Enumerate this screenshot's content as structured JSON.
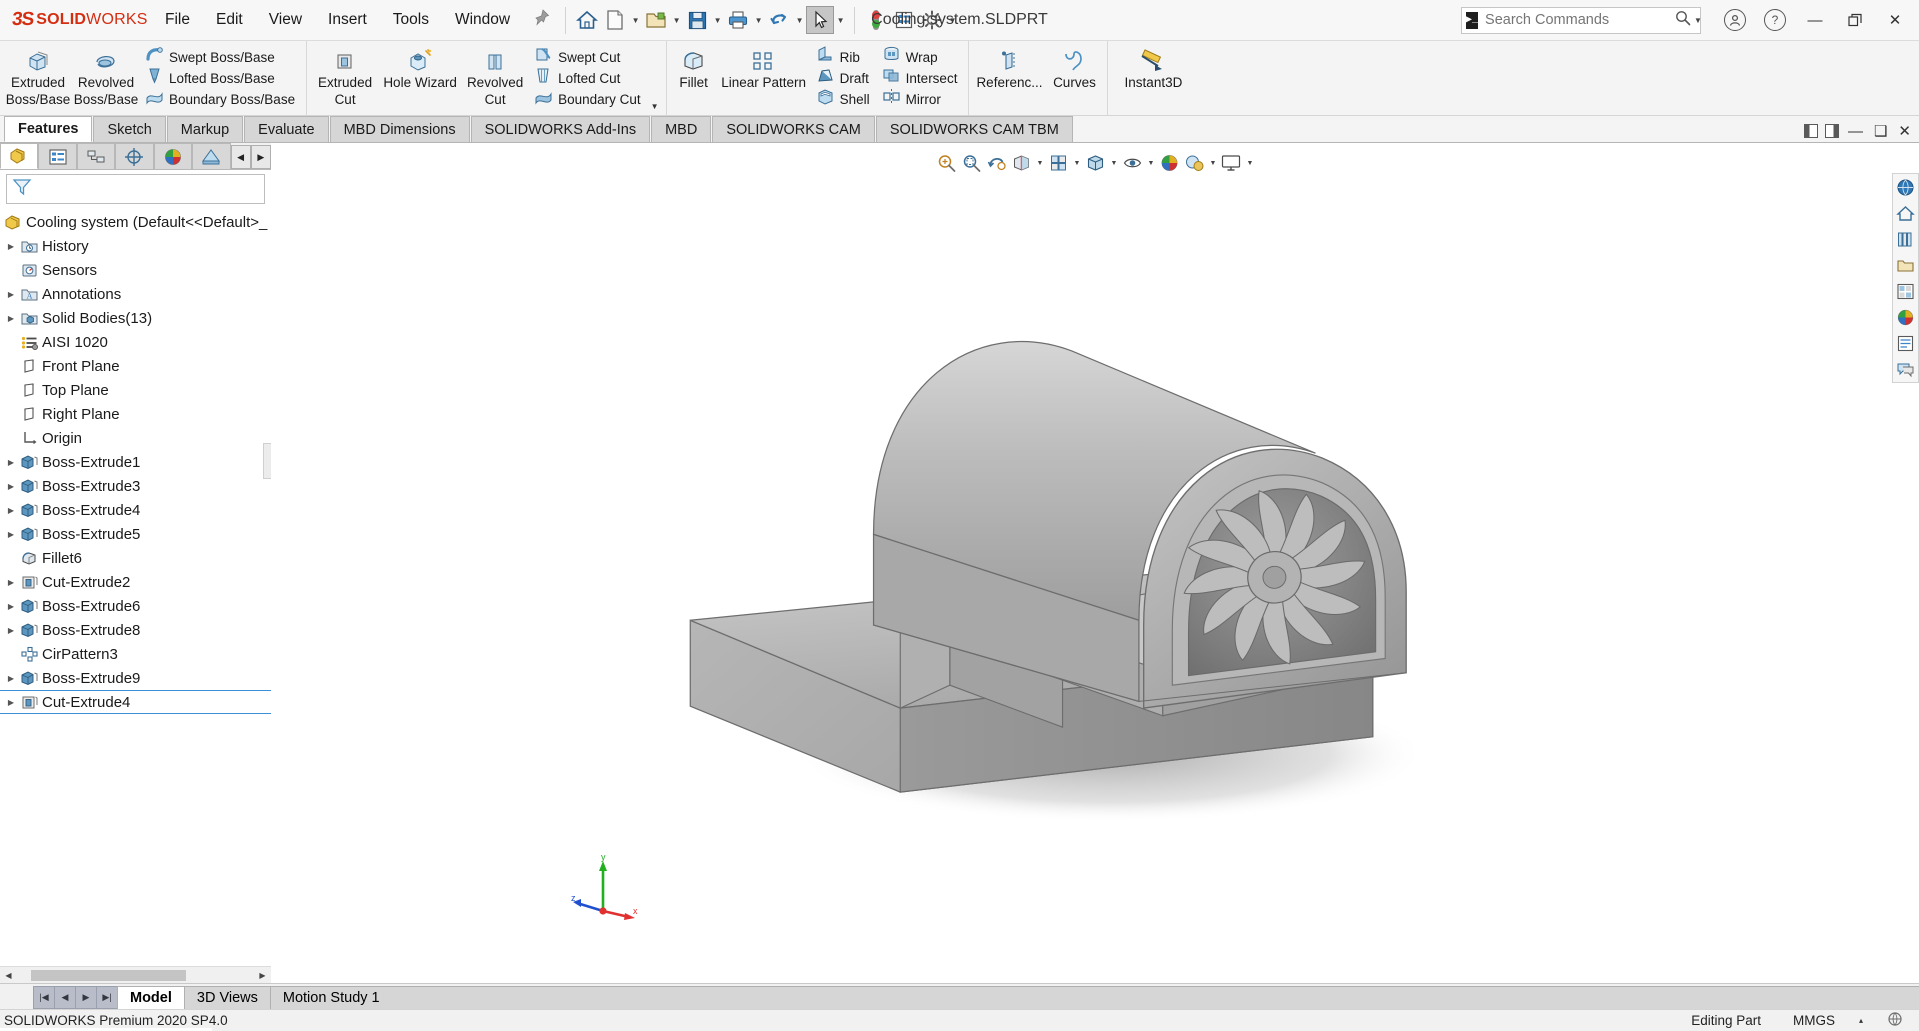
{
  "app": {
    "brand_main": "SOLID",
    "brand_light": "WORKS",
    "document_title": "Cooling system.SLDPRT",
    "version_status": "SOLIDWORKS Premium 2020 SP4.0"
  },
  "menu": {
    "items": [
      {
        "label": "File",
        "name": "menu-file"
      },
      {
        "label": "Edit",
        "name": "menu-edit"
      },
      {
        "label": "View",
        "name": "menu-view"
      },
      {
        "label": "Insert",
        "name": "menu-insert"
      },
      {
        "label": "Tools",
        "name": "menu-tools"
      },
      {
        "label": "Window",
        "name": "menu-window"
      }
    ],
    "pin_icon": "pushpin-icon"
  },
  "quick_access": {
    "buttons": [
      {
        "name": "home-icon",
        "tooltip": "Home"
      },
      {
        "name": "new-document-icon",
        "tooltip": "New"
      },
      {
        "name": "open-folder-icon",
        "tooltip": "Open"
      },
      {
        "name": "save-icon",
        "tooltip": "Save"
      },
      {
        "name": "print-icon",
        "tooltip": "Print"
      },
      {
        "name": "undo-icon",
        "tooltip": "Undo"
      },
      {
        "name": "select-arrow-icon",
        "tooltip": "Select"
      },
      {
        "name": "rebuild-traffic-light-icon",
        "tooltip": "Rebuild"
      },
      {
        "name": "file-properties-icon",
        "tooltip": "File Properties"
      },
      {
        "name": "options-gear-icon",
        "tooltip": "Options"
      }
    ]
  },
  "search": {
    "placeholder": "Search Commands",
    "value": "",
    "icon": "search-icon"
  },
  "window_controls": {
    "account": "account-circle-icon",
    "help": "help-circle-icon",
    "minimize": "minimize-icon",
    "restore": "restore-icon",
    "close": "close-icon"
  },
  "ribbon": {
    "groups": [
      {
        "name": "features-boss-group",
        "big": [
          {
            "label_lines": [
              "Extruded",
              "Boss/Base"
            ],
            "name": "extruded-boss-base-button",
            "icon": "extrude-icon",
            "caret": true
          },
          {
            "label_lines": [
              "Revolved",
              "Boss/Base"
            ],
            "name": "revolved-boss-base-button",
            "icon": "revolve-icon",
            "caret": true
          }
        ],
        "small": [
          {
            "label": "Swept Boss/Base",
            "name": "swept-boss-base-button",
            "icon": "swept-boss-icon"
          },
          {
            "label": "Lofted Boss/Base",
            "name": "lofted-boss-base-button",
            "icon": "lofted-boss-icon"
          },
          {
            "label": "Boundary Boss/Base",
            "name": "boundary-boss-base-button",
            "icon": "boundary-boss-icon"
          }
        ]
      },
      {
        "name": "features-cut-group",
        "big": [
          {
            "label_lines": [
              "Extruded",
              "Cut"
            ],
            "name": "extruded-cut-button",
            "icon": "extruded-cut-icon",
            "caret": true
          },
          {
            "label_lines": [
              "Hole Wizard",
              ""
            ],
            "name": "hole-wizard-button",
            "icon": "hole-wizard-icon",
            "caret": false
          },
          {
            "label_lines": [
              "Revolved",
              "Cut"
            ],
            "name": "revolved-cut-button",
            "icon": "revolved-cut-icon",
            "caret": true
          }
        ],
        "small": [
          {
            "label": "Swept Cut",
            "name": "swept-cut-button",
            "icon": "swept-cut-icon"
          },
          {
            "label": "Lofted Cut",
            "name": "lofted-cut-button",
            "icon": "lofted-cut-icon"
          },
          {
            "label": "Boundary Cut",
            "name": "boundary-cut-button",
            "icon": "boundary-cut-icon"
          }
        ]
      },
      {
        "name": "features-modify-group",
        "big": [
          {
            "label_lines": [
              "Fillet",
              ""
            ],
            "name": "fillet-button",
            "icon": "fillet-icon",
            "caret": true
          },
          {
            "label_lines": [
              "Linear Pattern",
              ""
            ],
            "name": "linear-pattern-button",
            "icon": "linear-pattern-icon",
            "caret": true
          }
        ],
        "small": [
          {
            "label": "Rib",
            "name": "rib-button",
            "icon": "rib-icon"
          },
          {
            "label": "Draft",
            "name": "draft-button",
            "icon": "draft-icon"
          },
          {
            "label": "Shell",
            "name": "shell-button",
            "icon": "shell-icon"
          }
        ],
        "small2": [
          {
            "label": "Wrap",
            "name": "wrap-button",
            "icon": "wrap-icon"
          },
          {
            "label": "Intersect",
            "name": "intersect-button",
            "icon": "intersect-icon"
          },
          {
            "label": "Mirror",
            "name": "mirror-button",
            "icon": "mirror-icon"
          }
        ]
      },
      {
        "name": "features-reference-group",
        "big": [
          {
            "label_lines": [
              "Referenc...",
              ""
            ],
            "name": "reference-geometry-button",
            "icon": "reference-plane-icon",
            "caret": true
          },
          {
            "label_lines": [
              "Curves",
              ""
            ],
            "name": "curves-button",
            "icon": "curves-icon",
            "caret": true
          }
        ],
        "small": []
      },
      {
        "name": "features-instant3d-group",
        "big": [
          {
            "label_lines": [
              "Instant3D",
              ""
            ],
            "name": "instant3d-button",
            "icon": "instant3d-icon",
            "caret": false
          }
        ],
        "small": []
      }
    ]
  },
  "command_tabs": {
    "items": [
      {
        "label": "Features",
        "name": "tab-features",
        "selected": true
      },
      {
        "label": "Sketch",
        "name": "tab-sketch",
        "selected": false
      },
      {
        "label": "Markup",
        "name": "tab-markup",
        "selected": false
      },
      {
        "label": "Evaluate",
        "name": "tab-evaluate",
        "selected": false
      },
      {
        "label": "MBD Dimensions",
        "name": "tab-mbd-dimensions",
        "selected": false
      },
      {
        "label": "SOLIDWORKS Add-Ins",
        "name": "tab-solidworks-add-ins",
        "selected": false
      },
      {
        "label": "MBD",
        "name": "tab-mbd",
        "selected": false
      },
      {
        "label": "SOLIDWORKS CAM",
        "name": "tab-solidworks-cam",
        "selected": false
      },
      {
        "label": "SOLIDWORKS CAM TBM",
        "name": "tab-solidworks-cam-tbm",
        "selected": false
      }
    ]
  },
  "feature_manager": {
    "tabs": [
      {
        "name": "featuremanager-design-tree-tab",
        "icon": "feature-tree-icon",
        "selected": true
      },
      {
        "name": "property-manager-tab",
        "icon": "property-manager-icon",
        "selected": false
      },
      {
        "name": "configuration-manager-tab",
        "icon": "configuration-manager-icon",
        "selected": false
      },
      {
        "name": "dimxpert-manager-tab",
        "icon": "dimxpert-icon",
        "selected": false
      },
      {
        "name": "display-manager-tab",
        "icon": "display-manager-icon",
        "selected": false
      },
      {
        "name": "cam-feature-tree-tab",
        "icon": "cam-tree-icon",
        "selected": false
      }
    ],
    "filter_placeholder": "",
    "filter_icon": "filter-funnel-icon",
    "tree": [
      {
        "label": "Cooling system  (Default<<Default>_",
        "icon": "part-icon",
        "indent": 0,
        "twisty": false,
        "name": "tree-item-part-root",
        "selected": false
      },
      {
        "label": "History",
        "icon": "history-folder-icon",
        "indent": 1,
        "twisty": true,
        "name": "tree-item-history",
        "selected": false
      },
      {
        "label": "Sensors",
        "icon": "sensors-icon",
        "indent": 1,
        "twisty": false,
        "name": "tree-item-sensors",
        "selected": false
      },
      {
        "label": "Annotations",
        "icon": "annotations-icon",
        "indent": 1,
        "twisty": true,
        "name": "tree-item-annotations",
        "selected": false
      },
      {
        "label": "Solid Bodies(13)",
        "icon": "solid-bodies-icon",
        "indent": 1,
        "twisty": true,
        "name": "tree-item-solid-bodies",
        "selected": false
      },
      {
        "label": "AISI 1020",
        "icon": "material-icon",
        "indent": 1,
        "twisty": false,
        "name": "tree-item-material",
        "selected": false
      },
      {
        "label": "Front Plane",
        "icon": "plane-icon",
        "indent": 1,
        "twisty": false,
        "name": "tree-item-front-plane",
        "selected": false
      },
      {
        "label": "Top Plane",
        "icon": "plane-icon",
        "indent": 1,
        "twisty": false,
        "name": "tree-item-top-plane",
        "selected": false
      },
      {
        "label": "Right Plane",
        "icon": "plane-icon",
        "indent": 1,
        "twisty": false,
        "name": "tree-item-right-plane",
        "selected": false
      },
      {
        "label": "Origin",
        "icon": "origin-icon",
        "indent": 1,
        "twisty": false,
        "name": "tree-item-origin",
        "selected": false
      },
      {
        "label": "Boss-Extrude1",
        "icon": "boss-extrude-icon",
        "indent": 1,
        "twisty": true,
        "name": "tree-item-boss-extrude1",
        "selected": false
      },
      {
        "label": "Boss-Extrude3",
        "icon": "boss-extrude-icon",
        "indent": 1,
        "twisty": true,
        "name": "tree-item-boss-extrude3",
        "selected": false
      },
      {
        "label": "Boss-Extrude4",
        "icon": "boss-extrude-icon",
        "indent": 1,
        "twisty": true,
        "name": "tree-item-boss-extrude4",
        "selected": false
      },
      {
        "label": "Boss-Extrude5",
        "icon": "boss-extrude-icon",
        "indent": 1,
        "twisty": true,
        "name": "tree-item-boss-extrude5",
        "selected": false
      },
      {
        "label": "Fillet6",
        "icon": "fillet-icon",
        "indent": 1,
        "twisty": false,
        "name": "tree-item-fillet6",
        "selected": false
      },
      {
        "label": "Cut-Extrude2",
        "icon": "cut-extrude-icon",
        "indent": 1,
        "twisty": true,
        "name": "tree-item-cut-extrude2",
        "selected": false
      },
      {
        "label": "Boss-Extrude6",
        "icon": "boss-extrude-icon",
        "indent": 1,
        "twisty": true,
        "name": "tree-item-boss-extrude6",
        "selected": false
      },
      {
        "label": "Boss-Extrude8",
        "icon": "boss-extrude-icon",
        "indent": 1,
        "twisty": true,
        "name": "tree-item-boss-extrude8",
        "selected": false
      },
      {
        "label": "CirPattern3",
        "icon": "circular-pattern-icon",
        "indent": 1,
        "twisty": false,
        "name": "tree-item-cirpattern3",
        "selected": false
      },
      {
        "label": "Boss-Extrude9",
        "icon": "boss-extrude-icon",
        "indent": 1,
        "twisty": true,
        "name": "tree-item-boss-extrude9",
        "selected": false
      },
      {
        "label": "Cut-Extrude4",
        "icon": "cut-extrude-icon",
        "indent": 1,
        "twisty": true,
        "name": "tree-item-cut-extrude4",
        "selected": true
      }
    ]
  },
  "view_toolbar": {
    "buttons": [
      {
        "name": "zoom-to-fit-icon"
      },
      {
        "name": "zoom-to-area-icon"
      },
      {
        "name": "previous-view-icon"
      },
      {
        "name": "section-view-icon"
      },
      {
        "name": "view-orientation-icon"
      },
      {
        "name": "display-style-icon"
      },
      {
        "name": "hide-show-items-icon"
      },
      {
        "name": "edit-appearance-icon"
      },
      {
        "name": "apply-scene-icon"
      },
      {
        "name": "view-settings-icon"
      }
    ]
  },
  "right_rail": {
    "buttons": [
      {
        "name": "3d-cad-resources-icon"
      },
      {
        "name": "home-resources-icon"
      },
      {
        "name": "design-library-icon"
      },
      {
        "name": "file-explorer-icon"
      },
      {
        "name": "view-palette-icon"
      },
      {
        "name": "appearances-scenes-icon"
      },
      {
        "name": "custom-properties-icon"
      },
      {
        "name": "solidworks-forum-icon"
      }
    ]
  },
  "triad": {
    "x_label": "x",
    "y_label": "y",
    "z_label": "z",
    "x_color": "#e03030",
    "y_color": "#20b020",
    "z_color": "#2050d0"
  },
  "bottom_tabs": {
    "nav": [
      "first-record-icon",
      "previous-record-icon",
      "next-record-icon",
      "last-record-icon"
    ],
    "items": [
      {
        "label": "Model",
        "name": "bottom-tab-model",
        "selected": true
      },
      {
        "label": "3D Views",
        "name": "bottom-tab-3d-views",
        "selected": false
      },
      {
        "label": "Motion Study 1",
        "name": "bottom-tab-motion-study-1",
        "selected": false
      }
    ]
  },
  "status_bar": {
    "left": "SOLIDWORKS Premium 2020 SP4.0",
    "editing": "Editing Part",
    "units": "MMGS",
    "caret": "▴",
    "sketch_icon": "unit-system-icon"
  },
  "model": {
    "description": "Cooling system housing with fan impeller, isometric shaded view",
    "body_color": "#a8a8a8",
    "shadow_color": "#bdbdbd"
  }
}
